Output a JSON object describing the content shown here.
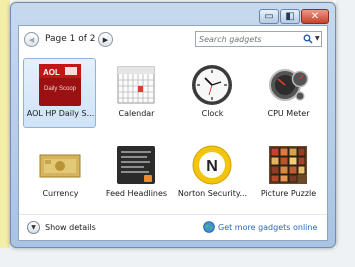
{
  "window": {
    "caption_buttons": {
      "minimize": "▭",
      "restore": "◧",
      "close": "✕"
    }
  },
  "toolbar": {
    "page_label": "Page 1 of 2",
    "prev_glyph": "◀",
    "next_glyph": "▶",
    "search_placeholder": "Search gadgets",
    "search_dropdown_glyph": "▼"
  },
  "gadgets": [
    {
      "label": "AOL HP Daily S...",
      "icon": "aol-daily-scoop-icon",
      "selected": true,
      "logo_text": "AOL",
      "logo_sub": "Daily Scoop"
    },
    {
      "label": "Calendar",
      "icon": "calendar-icon",
      "selected": false
    },
    {
      "label": "Clock",
      "icon": "clock-icon",
      "selected": false
    },
    {
      "label": "CPU Meter",
      "icon": "cpu-meter-icon",
      "selected": false
    },
    {
      "label": "Currency",
      "icon": "currency-icon",
      "selected": false
    },
    {
      "label": "Feed Headlines",
      "icon": "feed-headlines-icon",
      "selected": false
    },
    {
      "label": "Norton Security...",
      "icon": "norton-security-icon",
      "selected": false,
      "logo_text": "N"
    },
    {
      "label": "Picture Puzzle",
      "icon": "picture-puzzle-icon",
      "selected": false
    }
  ],
  "footer": {
    "details_label": "Show details",
    "details_glyph": "▼",
    "more_link": "Get more gadgets online"
  },
  "colors": {
    "window_frame": "#a9c3e2",
    "selected_tile": "#cfe3f8",
    "link": "#2a69b8",
    "close_button": "#c7412a"
  }
}
